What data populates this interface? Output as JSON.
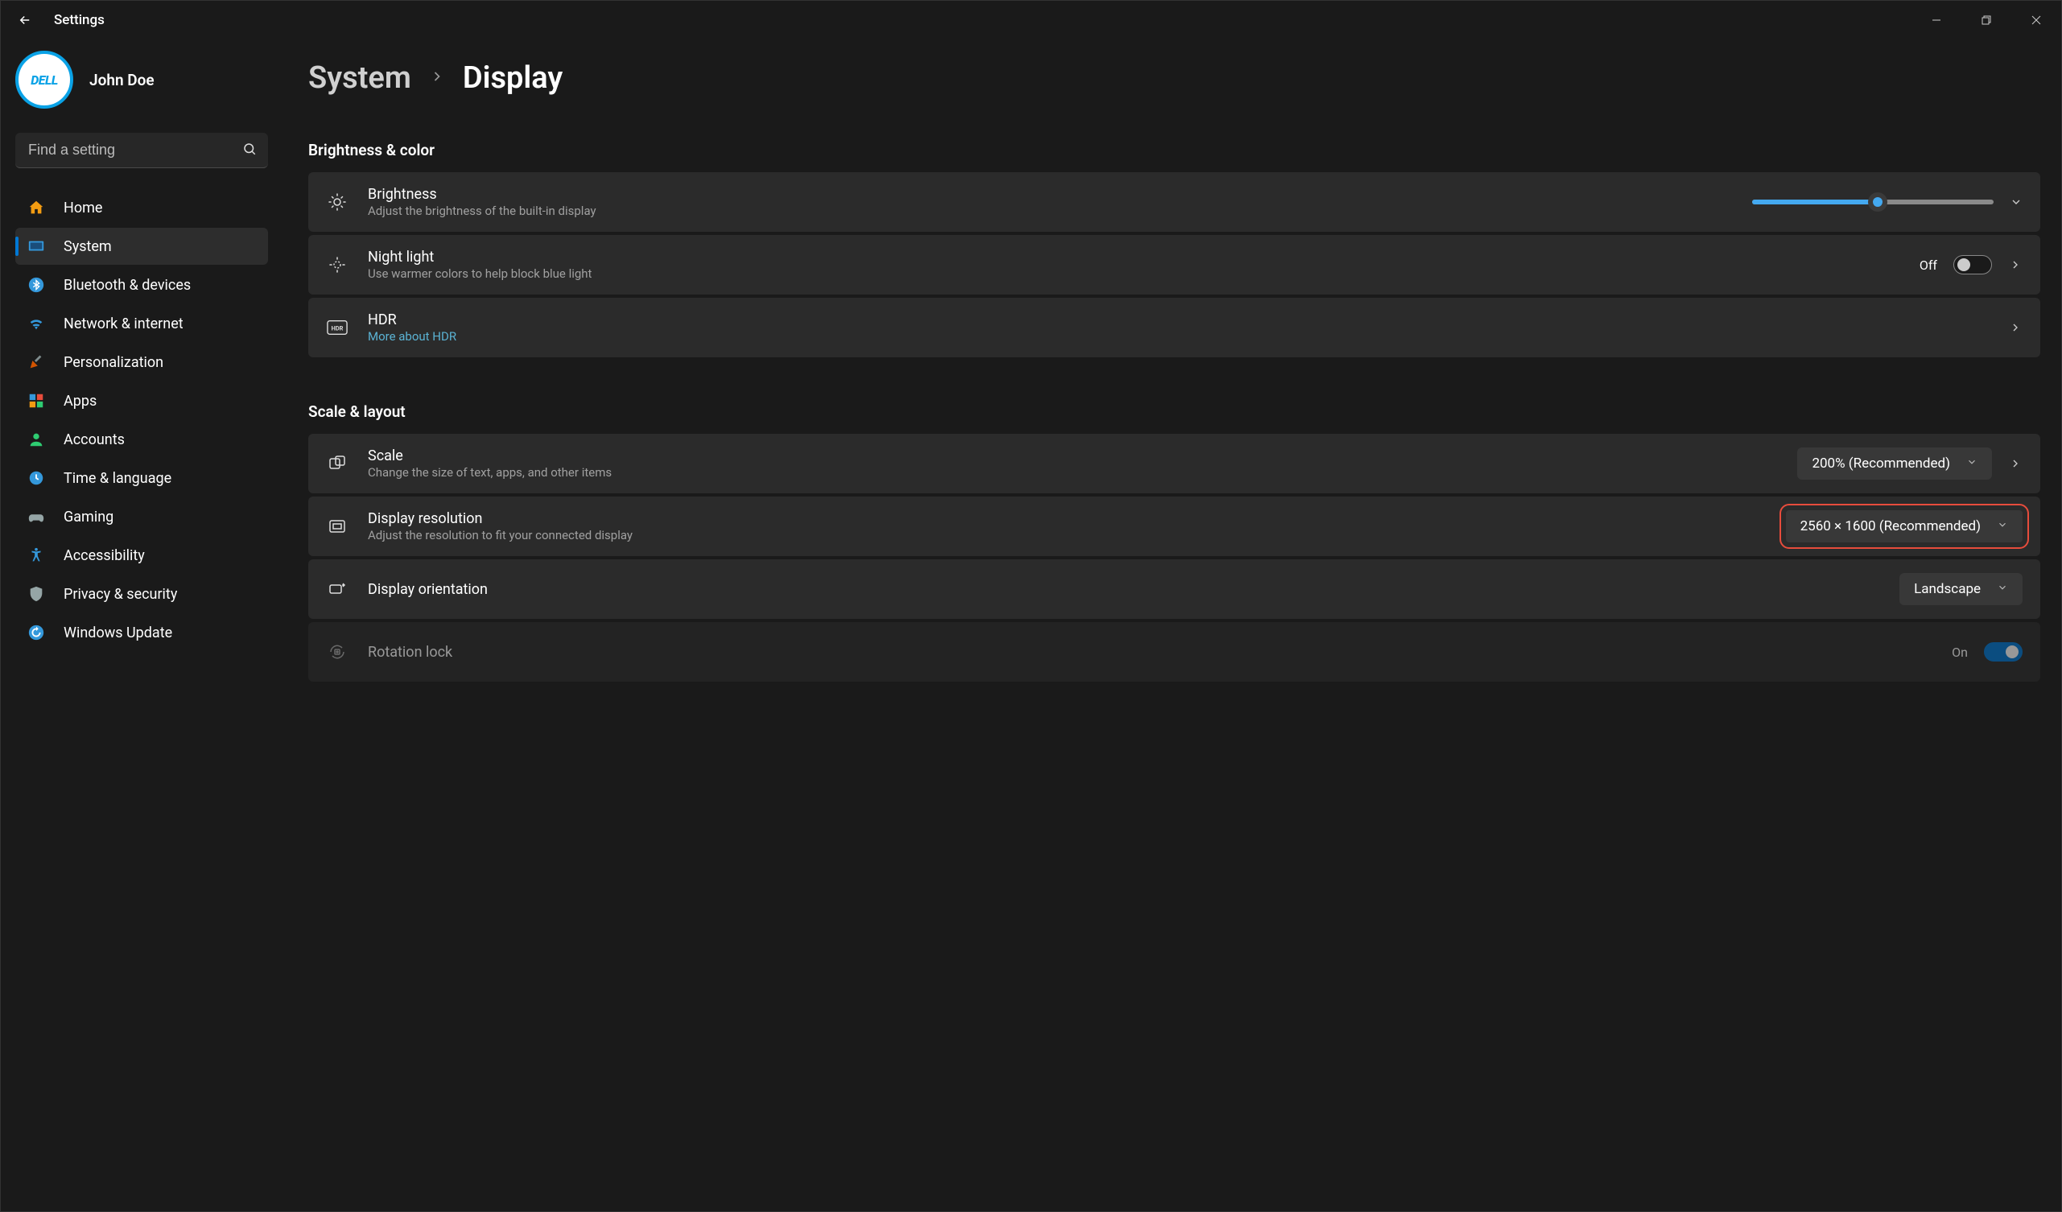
{
  "app": {
    "title": "Settings"
  },
  "profile": {
    "name": "John Doe",
    "avatar_text": "DELL"
  },
  "search": {
    "placeholder": "Find a setting"
  },
  "nav": {
    "items": [
      {
        "label": "Home"
      },
      {
        "label": "System"
      },
      {
        "label": "Bluetooth & devices"
      },
      {
        "label": "Network & internet"
      },
      {
        "label": "Personalization"
      },
      {
        "label": "Apps"
      },
      {
        "label": "Accounts"
      },
      {
        "label": "Time & language"
      },
      {
        "label": "Gaming"
      },
      {
        "label": "Accessibility"
      },
      {
        "label": "Privacy & security"
      },
      {
        "label": "Windows Update"
      }
    ]
  },
  "breadcrumb": {
    "parent": "System",
    "current": "Display"
  },
  "sections": {
    "brightness_color": {
      "title": "Brightness & color",
      "brightness": {
        "title": "Brightness",
        "sub": "Adjust the brightness of the built-in display",
        "value_percent": 52
      },
      "night_light": {
        "title": "Night light",
        "sub": "Use warmer colors to help block blue light",
        "state_label": "Off",
        "on": false
      },
      "hdr": {
        "title": "HDR",
        "link": "More about HDR"
      }
    },
    "scale_layout": {
      "title": "Scale & layout",
      "scale": {
        "title": "Scale",
        "sub": "Change the size of text, apps, and other items",
        "value": "200% (Recommended)"
      },
      "resolution": {
        "title": "Display resolution",
        "sub": "Adjust the resolution to fit your connected display",
        "value": "2560 × 1600 (Recommended)"
      },
      "orientation": {
        "title": "Display orientation",
        "value": "Landscape"
      },
      "rotation_lock": {
        "title": "Rotation lock",
        "state_label": "On",
        "on": true
      }
    }
  }
}
